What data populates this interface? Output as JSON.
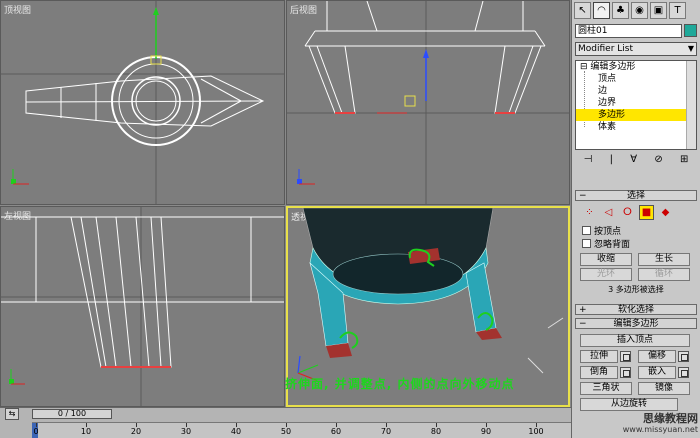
{
  "viewports": {
    "top": {
      "label": "顶视图"
    },
    "front": {
      "label": "后视图"
    },
    "left": {
      "label": "左视图"
    },
    "persp": {
      "label": "透视"
    }
  },
  "caption": "挤伸面, 并调整点, 内侧的点向外移动点",
  "command_panel": {
    "object_name": "圆柱01",
    "color": "#1fa99a",
    "modifier_list": "Modifier List",
    "stack": {
      "root": "编辑多边形",
      "items": [
        "顶点",
        "边",
        "边界",
        "多边形",
        "体素"
      ],
      "selected_index": 3
    },
    "rollouts": {
      "selection": "选择",
      "soft_selection": "软化选择",
      "edit_polygons": "编辑多边形"
    },
    "selection": {
      "by_vertex": "按顶点",
      "ignore_backfacing": "忽略背面",
      "shrink": "收缩",
      "grow": "生长",
      "ring": "光环",
      "loop": "循环",
      "status": "3 多边形被选择"
    },
    "edit": {
      "insert_vertex": "插入顶点",
      "extrude": "拉伸",
      "outline": "偏移",
      "bevel": "倒角",
      "inset": "嵌入",
      "triangulate": "三角状",
      "flip": "镜像",
      "hinge_from_edge": "从边旋转"
    },
    "watermark": {
      "line1": "思缘教程网",
      "line2": "www.missyuan.net"
    }
  },
  "timeline": {
    "frame_display": "0 / 100",
    "ticks": [
      "0",
      "10",
      "20",
      "30",
      "40",
      "50",
      "60",
      "70",
      "80",
      "90",
      "100"
    ]
  }
}
